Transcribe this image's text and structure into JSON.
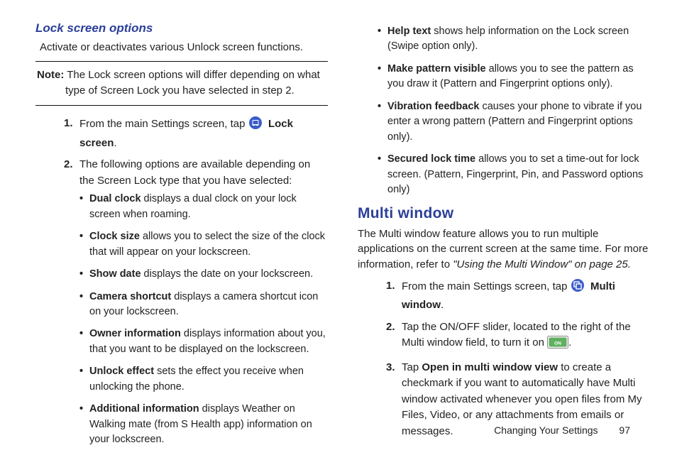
{
  "left": {
    "heading_lock": "Lock screen options",
    "lock_intro": "Activate or deactivates various Unlock screen functions.",
    "note_label": "Note:",
    "note_text": "The Lock screen options will differ depending on what type of Screen Lock you have selected in step 2.",
    "step1_a": "From the main Settings screen, tap ",
    "step1_b": "Lock screen",
    "step1_c": ".",
    "step2": "The following options are available depending on the Screen Lock type that you have selected:",
    "bullets": [
      {
        "b": "Dual clock",
        "t": " displays a dual clock on your lock screen when roaming."
      },
      {
        "b": "Clock size",
        "t": " allows you to select the size of the clock that will appear on your lockscreen."
      },
      {
        "b": "Show date",
        "t": " displays the date on your lockscreen."
      },
      {
        "b": "Camera shortcut",
        "t": " displays a camera shortcut icon on your lockscreen."
      },
      {
        "b": "Owner information",
        "t": " displays information about you, that you want to be displayed on the lockscreen."
      },
      {
        "b": "Unlock effect",
        "t": " sets the effect you receive when unlocking the phone."
      },
      {
        "b": "Additional information",
        "t": " displays Weather on Walking mate (from S Health app) information on your lockscreen."
      }
    ]
  },
  "right": {
    "bullets_cont": [
      {
        "b": "Help text",
        "t": " shows help information on the Lock screen (Swipe option only)."
      },
      {
        "b": "Make pattern visible",
        "t": " allows you to see the pattern as you draw it (Pattern and Fingerprint options only)."
      },
      {
        "b": "Vibration feedback",
        "t": " causes your phone to vibrate if you enter a wrong pattern (Pattern and Fingerprint options only)."
      },
      {
        "b": "Secured lock time",
        "t": " allows you to set a time-out for lock screen. (Pattern, Fingerprint, Pin, and Password options only)"
      }
    ],
    "heading_multi": "Multi window",
    "multi_intro_a": "The Multi window feature allows you to run multiple applications on the current screen at the same time. For more information, refer to ",
    "multi_intro_ref": "\"Using the Multi Window\"",
    "multi_intro_b": "  on page 25.",
    "mw_step1_a": "From the main Settings screen, tap ",
    "mw_step1_b": "Multi window",
    "mw_step1_c": ".",
    "mw_step2_a": "Tap the ON/OFF slider, located to the right of the Multi window field, to turn it on ",
    "mw_step2_b": ".",
    "mw_step3_a": "Tap ",
    "mw_step3_bold": "Open in multi window view",
    "mw_step3_b": " to create a checkmark if you want to automatically have Multi window activated whenever you open files from My Files, Video, or any attachments from emails or messages."
  },
  "footer": {
    "chapter": "Changing Your Settings",
    "page": "97"
  }
}
